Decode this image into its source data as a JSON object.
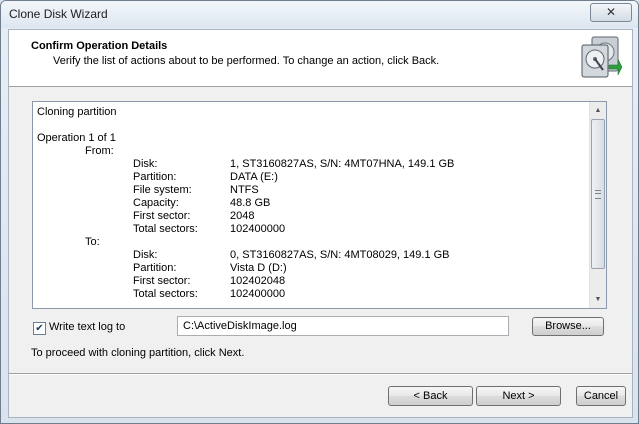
{
  "window": {
    "title": "Clone Disk Wizard",
    "close_glyph": "✕"
  },
  "header": {
    "title": "Confirm Operation Details",
    "subtitle": "Verify the list of actions about to be performed. To change an action, click Back.",
    "icon": "disk-drives-icon"
  },
  "details": {
    "heading": "Cloning partition",
    "operation": "Operation 1 of 1",
    "from_label": "From:",
    "from": [
      {
        "key": "Disk:",
        "value": "1, ST3160827AS, S/N: 4MT07HNA, 149.1 GB"
      },
      {
        "key": "Partition:",
        "value": "DATA (E:)"
      },
      {
        "key": "File system:",
        "value": "NTFS"
      },
      {
        "key": "Capacity:",
        "value": "48.8 GB"
      },
      {
        "key": "First sector:",
        "value": "2048"
      },
      {
        "key": "Total sectors:",
        "value": "102400000"
      }
    ],
    "to_label": "To:",
    "to": [
      {
        "key": "Disk:",
        "value": "0, ST3160827AS, S/N: 4MT08029, 149.1 GB"
      },
      {
        "key": "Partition:",
        "value": "Vista D (D:)"
      },
      {
        "key": "First sector:",
        "value": "102402048"
      },
      {
        "key": "Total sectors:",
        "value": "102400000"
      }
    ]
  },
  "log": {
    "checkbox_label": "Write text log to",
    "checked": true,
    "path": "C:\\ActiveDiskImage.log",
    "browse_label": "Browse..."
  },
  "hint": "To proceed with cloning partition, click Next.",
  "buttons": {
    "back": "< Back",
    "next": "Next >",
    "cancel": "Cancel"
  }
}
